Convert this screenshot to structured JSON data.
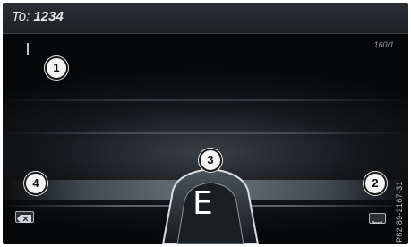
{
  "header": {
    "prefix": "To:",
    "number": "1234"
  },
  "counter": "160/1",
  "input": {
    "letter": "E"
  },
  "callouts": {
    "c1": "1",
    "c2": "2",
    "c3": "3",
    "c4": "4"
  },
  "side_code": "P82.89-2167-31"
}
